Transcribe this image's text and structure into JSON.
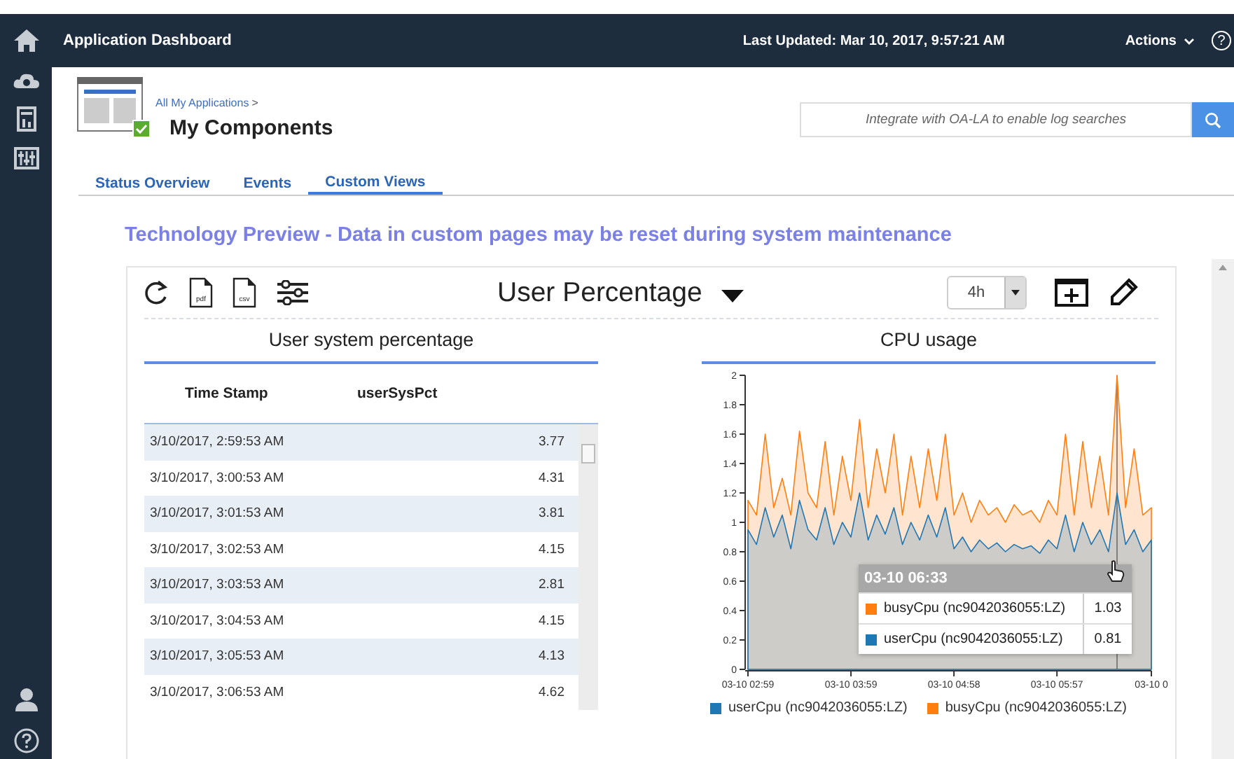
{
  "header": {
    "title": "Application Dashboard",
    "last_updated": "Last Updated: Mar 10, 2017, 9:57:21 AM",
    "actions": "Actions",
    "help": "?"
  },
  "breadcrumb": {
    "parent": "All My Applications",
    "separator": ">",
    "title": "My Components"
  },
  "search": {
    "placeholder": "Integrate with OA-LA to enable log searches"
  },
  "tabs": [
    {
      "label": "Status Overview",
      "selected": false
    },
    {
      "label": "Events",
      "selected": false
    },
    {
      "label": "Custom Views",
      "selected": true
    }
  ],
  "notice": "Technology Preview - Data in custom pages may be reset during system maintenance",
  "widget": {
    "export_buttons": [
      "pdf",
      "csv"
    ],
    "title": "User Percentage",
    "time_range": "4h",
    "table": {
      "title": "User system percentage",
      "columns": [
        "Time Stamp",
        "userSysPct"
      ],
      "rows": [
        [
          "3/10/2017, 2:59:53 AM",
          "3.77"
        ],
        [
          "3/10/2017, 3:00:53 AM",
          "4.31"
        ],
        [
          "3/10/2017, 3:01:53 AM",
          "3.81"
        ],
        [
          "3/10/2017, 3:02:53 AM",
          "4.15"
        ],
        [
          "3/10/2017, 3:03:53 AM",
          "2.81"
        ],
        [
          "3/10/2017, 3:04:53 AM",
          "4.15"
        ],
        [
          "3/10/2017, 3:05:53 AM",
          "4.13"
        ],
        [
          "3/10/2017, 3:06:53 AM",
          "4.62"
        ]
      ]
    },
    "chart": {
      "title": "CPU usage",
      "chart_data": {
        "type": "area",
        "categories": [
          "03-10 02:59",
          null,
          null,
          null,
          null,
          null,
          null,
          null,
          null,
          null,
          null,
          null,
          "03-10 03:59",
          null,
          null,
          null,
          null,
          null,
          null,
          null,
          null,
          null,
          null,
          null,
          "03-10 04:58",
          null,
          null,
          null,
          null,
          null,
          null,
          null,
          null,
          null,
          null,
          null,
          "03-10 05:57",
          null,
          null,
          null,
          null,
          null,
          null,
          null,
          null,
          null,
          null,
          "03-10 0"
        ],
        "series": [
          {
            "name": "userCpu (nc9042036055:LZ)",
            "color": "#1f77b4",
            "values": [
              0.95,
              0.85,
              1.1,
              0.9,
              1.05,
              0.82,
              1.15,
              0.95,
              0.88,
              1.1,
              0.85,
              1.0,
              0.9,
              1.2,
              0.88,
              1.05,
              0.92,
              1.1,
              0.85,
              1.0,
              0.88,
              1.05,
              0.9,
              1.1,
              0.82,
              0.9,
              0.8,
              0.88,
              0.82,
              0.86,
              0.8,
              0.85,
              0.82,
              0.84,
              0.79,
              0.88,
              0.82,
              1.05,
              0.8,
              1.0,
              0.85,
              0.95,
              0.8,
              1.2,
              0.85,
              0.95,
              0.8,
              0.88
            ]
          },
          {
            "name": "busyCpu (nc9042036055:LZ)",
            "color": "#ff7f0e",
            "values": [
              1.15,
              1.05,
              1.6,
              1.1,
              1.3,
              1.05,
              1.62,
              1.2,
              1.1,
              1.55,
              1.05,
              1.45,
              1.15,
              1.7,
              1.1,
              1.5,
              1.2,
              1.6,
              1.05,
              1.45,
              1.1,
              1.5,
              1.15,
              1.6,
              1.05,
              1.2,
              1.0,
              1.15,
              1.05,
              1.1,
              1.0,
              1.12,
              1.05,
              1.08,
              1.0,
              1.15,
              1.05,
              1.6,
              1.05,
              1.55,
              1.1,
              1.45,
              1.05,
              2.0,
              1.1,
              1.5,
              1.05,
              1.1
            ]
          }
        ],
        "ylim": [
          0,
          2
        ],
        "yticks": [
          0,
          0.2,
          0.4,
          0.6,
          0.8,
          1,
          1.2,
          1.4,
          1.6,
          1.8,
          2
        ]
      },
      "tooltip": {
        "title": "03-10 06:33",
        "rows": [
          {
            "name": "busyCpu (nc9042036055:LZ)",
            "color": "#ff7f0e",
            "value": "1.03"
          },
          {
            "name": "userCpu (nc9042036055:LZ)",
            "color": "#1f77b4",
            "value": "0.81"
          }
        ]
      }
    }
  }
}
